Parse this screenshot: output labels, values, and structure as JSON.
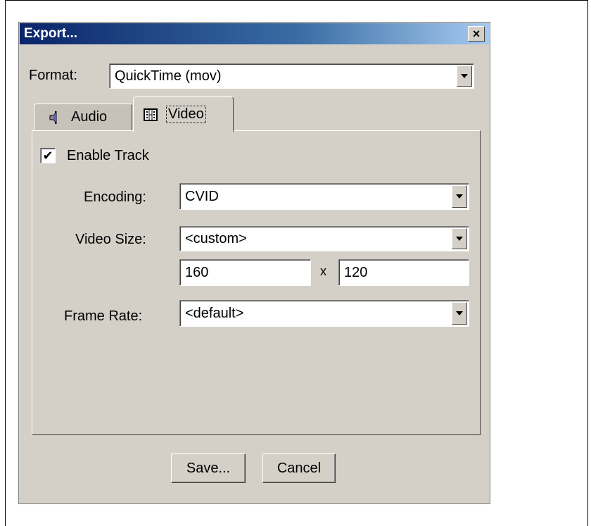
{
  "window": {
    "title": "Export...",
    "close_symbol": "×"
  },
  "format": {
    "label": "Format:",
    "value": "QuickTime (mov)"
  },
  "tabs": [
    {
      "label": "Audio",
      "icon": "speaker-icon",
      "selected": false
    },
    {
      "label": "Video",
      "icon": "film-icon",
      "selected": true
    }
  ],
  "video": {
    "enable_track": {
      "label": "Enable Track",
      "checked": true,
      "check_symbol": "✔"
    },
    "encoding": {
      "label": "Encoding:",
      "value": "CVID"
    },
    "video_size": {
      "label": "Video Size:",
      "value": "<custom>",
      "width": "160",
      "separator": "x",
      "height": "120"
    },
    "frame_rate": {
      "label": "Frame Rate:",
      "value": "<default>"
    }
  },
  "buttons": {
    "save": "Save...",
    "cancel": "Cancel"
  }
}
